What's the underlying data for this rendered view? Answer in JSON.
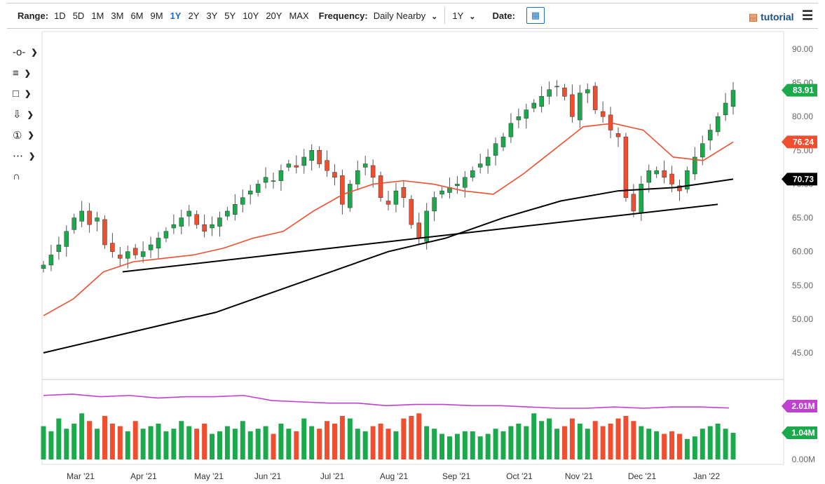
{
  "toolbar": {
    "range_label": "Range:",
    "ranges": [
      "1D",
      "5D",
      "1M",
      "3M",
      "6M",
      "9M",
      "1Y",
      "2Y",
      "3Y",
      "5Y",
      "10Y",
      "20Y",
      "MAX"
    ],
    "active_range": "1Y",
    "frequency_label": "Frequency:",
    "frequency_value": "Daily Nearby",
    "period_value": "1Y",
    "date_label": "Date:",
    "tutorial": "tutorial"
  },
  "tools": [
    "crosshair-tool",
    "fib-tool",
    "rectangle-tool",
    "arrow-tool",
    "annotation-tool",
    "pitchfork-tool",
    "magnet-tool"
  ],
  "colors": {
    "up": "#1aaa4b",
    "down": "#f04e2f",
    "ma50": "#f04e2f",
    "ma200": "#000000",
    "avgvol": "#c040d0",
    "accent": "#1a6fc4"
  },
  "chart_data": {
    "type": "candlestick",
    "x_ticks": [
      "Mar '21",
      "Apr '21",
      "May '21",
      "Jun '21",
      "Jul '21",
      "Aug '21",
      "Sep '21",
      "Oct '21",
      "Nov '21",
      "Dec '21",
      "Jan '22"
    ],
    "y_ticks": [
      "90.00",
      "85.00",
      "80.00",
      "75.00",
      "70.00",
      "65.00",
      "60.00",
      "55.00",
      "50.00",
      "45.00"
    ],
    "ylim": [
      45,
      90
    ],
    "closes": [
      58,
      59.5,
      61,
      63,
      65,
      66,
      64,
      65,
      61,
      60,
      59,
      60,
      59.5,
      60,
      61,
      62,
      63,
      64,
      65,
      66,
      64,
      63,
      64,
      65,
      66,
      67,
      68,
      69,
      70,
      71,
      70.5,
      72,
      73,
      72.5,
      74,
      75,
      73,
      72,
      71,
      67,
      70,
      72,
      73,
      71,
      68,
      67,
      69,
      68,
      64,
      62,
      66,
      68,
      69,
      69.5,
      70,
      71,
      72,
      73,
      74,
      76,
      77,
      79,
      80,
      81,
      82,
      83,
      84,
      84.5,
      83,
      80,
      83.5,
      84,
      81,
      80,
      78,
      77,
      68,
      66,
      70,
      72,
      72,
      71,
      70,
      69,
      72,
      74,
      76,
      78,
      80,
      82,
      83.91
    ],
    "ma50": [
      50.5,
      53,
      57,
      58.5,
      59,
      59.5,
      60.5,
      62,
      63,
      66,
      68.5,
      70,
      70.5,
      70,
      69,
      68.5,
      71.5,
      75,
      78.5,
      79,
      78,
      74,
      73.5,
      76.24
    ],
    "ma200": [
      45,
      47,
      49,
      51,
      54,
      57,
      60,
      62,
      65,
      67.5,
      69,
      69.5,
      70.73
    ],
    "trendline": [
      57,
      67
    ],
    "last_price": "83.91",
    "ma50_label": "76.24",
    "ma200_label": "70.73",
    "volume": {
      "y_ticks": [
        "0.00M"
      ],
      "avg_label": "2.01M",
      "last_label": "1.04M",
      "values": [
        1.3,
        1.1,
        1.6,
        1.2,
        1.4,
        1.8,
        1.5,
        1.2,
        1.7,
        1.4,
        1.3,
        1.1,
        1.5,
        1.2,
        1.3,
        1.4,
        1.1,
        1.2,
        1.5,
        1.3,
        1.2,
        1.4,
        1.0,
        1.1,
        1.3,
        1.2,
        1.5,
        1.1,
        1.2,
        1.3,
        1.0,
        1.4,
        1.2,
        1.1,
        1.6,
        1.3,
        1.2,
        1.5,
        1.4,
        1.7,
        1.6,
        1.2,
        1.1,
        1.3,
        1.4,
        1.2,
        1.1,
        1.6,
        1.7,
        1.8,
        1.3,
        1.2,
        1.0,
        0.9,
        1.0,
        1.1,
        1.1,
        0.9,
        1.0,
        1.2,
        1.1,
        1.3,
        1.4,
        1.3,
        1.8,
        1.5,
        1.6,
        1.2,
        1.3,
        1.6,
        1.4,
        1.2,
        1.5,
        1.3,
        1.4,
        1.6,
        1.7,
        1.5,
        1.3,
        1.2,
        1.1,
        1.0,
        1.1,
        1.0,
        0.8,
        0.9,
        1.2,
        1.3,
        1.4,
        1.2,
        1.04
      ],
      "avg": [
        2.5,
        2.55,
        2.45,
        2.5,
        2.4,
        2.45,
        2.45,
        2.5,
        2.3,
        2.25,
        2.2,
        2.2,
        2.1,
        2.15,
        2.15,
        2.1,
        2.1,
        2.05,
        2.0,
        2.0,
        2.05,
        2.0,
        2.05,
        2.05,
        2.01
      ]
    }
  }
}
